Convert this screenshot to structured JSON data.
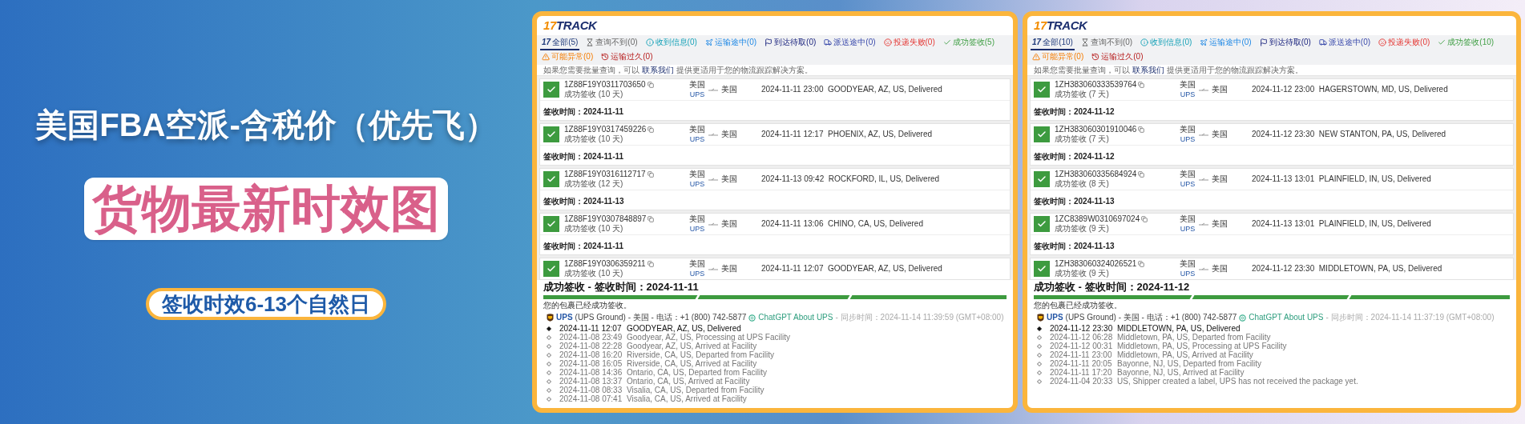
{
  "banner": {
    "title": "美国FBA空派-含税价（优先飞）",
    "headline": "货物最新时效图",
    "tag": "签收时效6-13个自然日"
  },
  "panels": [
    {
      "logo": {
        "number": "17",
        "word": "TRACK"
      },
      "tabs": [
        {
          "kind": "logo",
          "mark": "17",
          "label": "全部(5)",
          "selected": true
        },
        {
          "kind": "hourglass",
          "label": "查询不到(0)",
          "selected": false
        },
        {
          "kind": "info",
          "label": "收到信息(0)",
          "selected": false
        },
        {
          "kind": "plane",
          "label": "运输途中(0)",
          "selected": false
        },
        {
          "kind": "flag",
          "label": "到达待取(0)",
          "selected": false
        },
        {
          "kind": "truck",
          "label": "派送途中(0)",
          "selected": false
        },
        {
          "kind": "sad",
          "label": "投递失败(0)",
          "selected": false
        },
        {
          "kind": "check",
          "label": "成功签收(5)",
          "selected": false
        },
        {
          "kind": "warning",
          "label": "可能异常(0)",
          "selected": false
        },
        {
          "kind": "history",
          "label": "运输过久(0)",
          "selected": false
        }
      ],
      "notice": {
        "before": "如果您需要批量查询，可以 ",
        "link": "联系我们",
        "after": " 提供更适用于您的物流跟踪解决方案。"
      },
      "shipments": [
        {
          "number": "1Z88F19Y0311703650",
          "status": "成功签收 (10 天)",
          "origin": "美国",
          "carrier": "UPS",
          "destination": "美国",
          "latest": "2024-11-11 23:00  GOODYEAR, AZ, US, Delivered",
          "signed": "签收时间：2024-11-11"
        },
        {
          "number": "1Z88F19Y0317459226",
          "status": "成功签收 (10 天)",
          "origin": "美国",
          "carrier": "UPS",
          "destination": "美国",
          "latest": "2024-11-11 12:17  PHOENIX, AZ, US, Delivered",
          "signed": "签收时间：2024-11-11"
        },
        {
          "number": "1Z88F19Y0316112717",
          "status": "成功签收 (12 天)",
          "origin": "美国",
          "carrier": "UPS",
          "destination": "美国",
          "latest": "2024-11-13 09:42  ROCKFORD, IL, US, Delivered",
          "signed": "签收时间：2024-11-13"
        },
        {
          "number": "1Z88F19Y0307848897",
          "status": "成功签收 (10 天)",
          "origin": "美国",
          "carrier": "UPS",
          "destination": "美国",
          "latest": "2024-11-11 13:06  CHINO, CA, US, Delivered",
          "signed": "签收时间：2024-11-11"
        },
        {
          "number": "1Z88F19Y0306359211",
          "status": "成功签收 (10 天)",
          "origin": "美国",
          "carrier": "UPS",
          "destination": "美国",
          "latest": "2024-11-11 12:07  GOODYEAR, AZ, US, Delivered"
        }
      ],
      "detail": {
        "heading": "成功签收 - 签收时间：2024-11-11",
        "progress": {
          "level": 1
        },
        "message": "您的包裹已经成功签收。",
        "carrier": {
          "name": "UPS",
          "service": "(UPS Ground) - 美国 - 电话：+1 (800) 742-5877",
          "assistant": "ChatGPT About UPS",
          "sync": "- 同步时间：2024-11-14 11:39:59 (GMT+08:00)"
        },
        "events": [
          {
            "time": "2024-11-11 12:07",
            "text": "GOODYEAR, AZ, US, Delivered",
            "latest": true
          },
          {
            "time": "2024-11-08 23:49",
            "text": "Goodyear, AZ, US, Processing at UPS Facility",
            "latest": false
          },
          {
            "time": "2024-11-08 22:28",
            "text": "Goodyear, AZ, US, Arrived at Facility",
            "latest": false
          },
          {
            "time": "2024-11-08 16:20",
            "text": "Riverside, CA, US, Departed from Facility",
            "latest": false
          },
          {
            "time": "2024-11-08 16:05",
            "text": "Riverside, CA, US, Arrived at Facility",
            "latest": false
          },
          {
            "time": "2024-11-08 14:36",
            "text": "Ontario, CA, US, Departed from Facility",
            "latest": false
          },
          {
            "time": "2024-11-08 13:37",
            "text": "Ontario, CA, US, Arrived at Facility",
            "latest": false
          },
          {
            "time": "2024-11-08 08:33",
            "text": "Visalia, CA, US, Departed from Facility",
            "latest": false
          },
          {
            "time": "2024-11-08 07:41",
            "text": "Visalia, CA, US, Arrived at Facility",
            "latest": false
          }
        ]
      }
    },
    {
      "logo": {
        "number": "17",
        "word": "TRACK"
      },
      "tabs": [
        {
          "kind": "logo",
          "mark": "17",
          "label": "全部(10)",
          "selected": true
        },
        {
          "kind": "hourglass",
          "label": "查询不到(0)",
          "selected": false
        },
        {
          "kind": "info",
          "label": "收到信息(0)",
          "selected": false
        },
        {
          "kind": "plane",
          "label": "运输途中(0)",
          "selected": false
        },
        {
          "kind": "flag",
          "label": "到达待取(0)",
          "selected": false
        },
        {
          "kind": "truck",
          "label": "派送途中(0)",
          "selected": false
        },
        {
          "kind": "sad",
          "label": "投递失败(0)",
          "selected": false
        },
        {
          "kind": "check",
          "label": "成功签收(10)",
          "selected": false
        },
        {
          "kind": "warning",
          "label": "可能异常(0)",
          "selected": false
        },
        {
          "kind": "history",
          "label": "运输过久(0)",
          "selected": false
        }
      ],
      "notice": {
        "before": "如果您需要批量查询，可以 ",
        "link": "联系我们",
        "after": " 提供更适用于您的物流跟踪解决方案。"
      },
      "shipments": [
        {
          "number": "1ZH383060333539764",
          "status": "成功签收 (7 天)",
          "origin": "美国",
          "carrier": "UPS",
          "destination": "美国",
          "latest": "2024-11-12 23:00  HAGERSTOWN, MD, US, Delivered",
          "signed": "签收时间：2024-11-12"
        },
        {
          "number": "1ZH383060301910046",
          "status": "成功签收 (7 天)",
          "origin": "美国",
          "carrier": "UPS",
          "destination": "美国",
          "latest": "2024-11-12 23:30  NEW STANTON, PA, US, Delivered",
          "signed": "签收时间：2024-11-12"
        },
        {
          "number": "1ZH383060335684924",
          "status": "成功签收 (8 天)",
          "origin": "美国",
          "carrier": "UPS",
          "destination": "美国",
          "latest": "2024-11-13 13:01  PLAINFIELD, IN, US, Delivered",
          "signed": "签收时间：2024-11-13"
        },
        {
          "number": "1ZC8389W0310697024",
          "status": "成功签收 (9 天)",
          "origin": "美国",
          "carrier": "UPS",
          "destination": "美国",
          "latest": "2024-11-13 13:01  PLAINFIELD, IN, US, Delivered",
          "signed": "签收时间：2024-11-13"
        },
        {
          "number": "1ZH383060324026521",
          "status": "成功签收 (9 天)",
          "origin": "美国",
          "carrier": "UPS",
          "destination": "美国",
          "latest": "2024-11-12 23:30  MIDDLETOWN, PA, US, Delivered"
        }
      ],
      "detail": {
        "heading": "成功签收 - 签收时间：2024-11-12",
        "progress": {
          "level": 1
        },
        "message": "您的包裹已经成功签收。",
        "carrier": {
          "name": "UPS",
          "service": "(UPS Ground) - 美国 - 电话：+1 (800) 742-5877",
          "assistant": "ChatGPT About UPS",
          "sync": "- 同步时间：2024-11-14 11:37:19 (GMT+08:00)"
        },
        "events": [
          {
            "time": "2024-11-12 23:30",
            "text": "MIDDLETOWN, PA, US, Delivered",
            "latest": true
          },
          {
            "time": "2024-11-12 06:28",
            "text": "Middletown, PA, US, Departed from Facility",
            "latest": false
          },
          {
            "time": "2024-11-12 00:31",
            "text": "Middletown, PA, US, Processing at UPS Facility",
            "latest": false
          },
          {
            "time": "2024-11-11 23:00",
            "text": "Middletown, PA, US, Arrived at Facility",
            "latest": false
          },
          {
            "time": "2024-11-11 20:05",
            "text": "Bayonne, NJ, US, Departed from Facility",
            "latest": false
          },
          {
            "time": "2024-11-11 17:20",
            "text": "Bayonne, NJ, US, Arrived at Facility",
            "latest": false
          },
          {
            "time": "2024-11-04 20:33",
            "text": "US, Shipper created a label, UPS has not received the package yet.",
            "latest": false
          }
        ]
      }
    }
  ]
}
